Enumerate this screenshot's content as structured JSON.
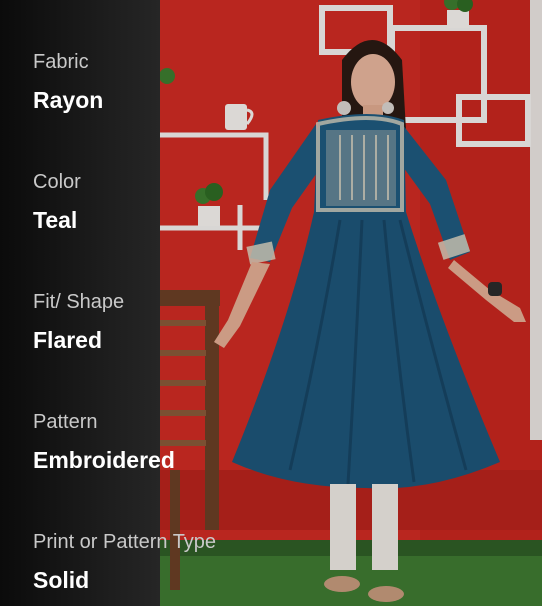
{
  "colors": {
    "overlay_dark": "#0b0b0b",
    "wall_red": "#cf2b23",
    "dress_teal": "#1f5a7e",
    "embroidery": "#d9d2c0",
    "grass": "#3f7a32"
  },
  "product_image": {
    "subject": "teal flared embroidered kurta",
    "icons": [
      "plant-pot-icon",
      "mug-icon",
      "wall-shelf-icon",
      "chair-icon"
    ]
  },
  "attributes": [
    {
      "label": "Fabric",
      "value": "Rayon"
    },
    {
      "label": "Color",
      "value": "Teal"
    },
    {
      "label": "Fit/ Shape",
      "value": "Flared"
    },
    {
      "label": "Pattern",
      "value": "Embroidered"
    },
    {
      "label": "Print or Pattern Type",
      "value": "Solid"
    }
  ]
}
